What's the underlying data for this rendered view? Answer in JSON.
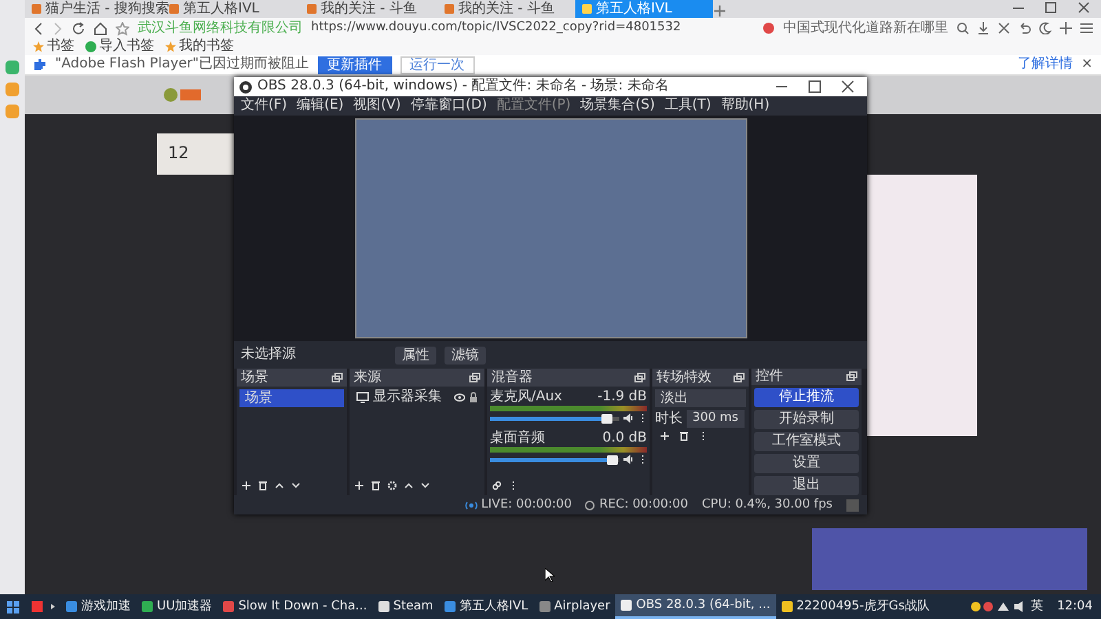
{
  "browser": {
    "tabs": [
      {
        "title": "猫户生活 - 搜狗搜索",
        "selected": false
      },
      {
        "title": "第五人格IVL",
        "selected": false
      },
      {
        "title": "我的关注 - 斗鱼",
        "selected": false
      },
      {
        "title": "我的关注 - 斗鱼",
        "selected": false
      },
      {
        "title": "第五人格IVL",
        "selected": true
      }
    ],
    "address": {
      "site": "武汉斗鱼网络科技有限公司",
      "url": "https://www.douyu.com/topic/IVSC2022_copy?rid=4801532"
    },
    "search": {
      "value": "中国式现代化道路新在哪里"
    },
    "bookmarks": [
      "书签",
      "导入书签",
      "我的书签"
    ],
    "infobar": {
      "message": "\"Adobe Flash Player\"已因过期而被阻止",
      "buttons": [
        "更新插件",
        "运行一次"
      ],
      "link": "了解详情",
      "close": "×"
    },
    "page": {
      "follow_count": "12"
    }
  },
  "obs": {
    "title": "OBS 28.0.3 (64-bit, windows) - 配置文件: 未命名 - 场景: 未命名",
    "menu": [
      "文件(F)",
      "编辑(E)",
      "视图(V)",
      "停靠窗口(D)",
      "配置文件(P)",
      "场景集合(S)",
      "工具(T)",
      "帮助(H)"
    ],
    "source_toolbar": {
      "label": "未选择源",
      "buttons": [
        "属性",
        "滤镜"
      ]
    },
    "scenes": {
      "title": "场景",
      "items": [
        {
          "name": "场景",
          "selected": true
        }
      ]
    },
    "sources": {
      "title": "来源",
      "items": [
        {
          "name": "显示器采集"
        }
      ]
    },
    "mixer": {
      "title": "混音器",
      "channels": [
        {
          "name": "麦克风/Aux",
          "reading": "-1.9 dB",
          "level": 0.9
        },
        {
          "name": "桌面音频",
          "reading": "0.0 dB",
          "level": 0.95
        }
      ]
    },
    "transitions": {
      "title": "转场特效",
      "type": "淡出",
      "duration_label": "时长",
      "duration": "300 ms"
    },
    "controls": {
      "title": "控件",
      "buttons": [
        {
          "label": "停止推流",
          "active": true
        },
        {
          "label": "开始录制",
          "active": false
        },
        {
          "label": "工作室模式",
          "active": false
        },
        {
          "label": "设置",
          "active": false
        },
        {
          "label": "退出",
          "active": false
        }
      ]
    },
    "status": {
      "live": "LIVE: 00:00:00",
      "rec": "REC: 00:00:00",
      "cpu": "CPU: 0.4%, 30.00 fps"
    }
  },
  "taskbar": {
    "items": [
      {
        "label": "游戏加速",
        "selected": false
      },
      {
        "label": "UU加速器",
        "selected": false
      },
      {
        "label": "Slow It Down - Cha...",
        "selected": false
      },
      {
        "label": "Steam",
        "selected": false
      },
      {
        "label": "第五人格IVL",
        "selected": false
      },
      {
        "label": "Airplayer",
        "selected": false
      },
      {
        "label": "OBS 28.0.3 (64-bit, ...",
        "selected": true
      },
      {
        "label": "22200495-虎牙Gs战队",
        "selected": false
      }
    ],
    "language": "英",
    "clock": "12:04"
  }
}
